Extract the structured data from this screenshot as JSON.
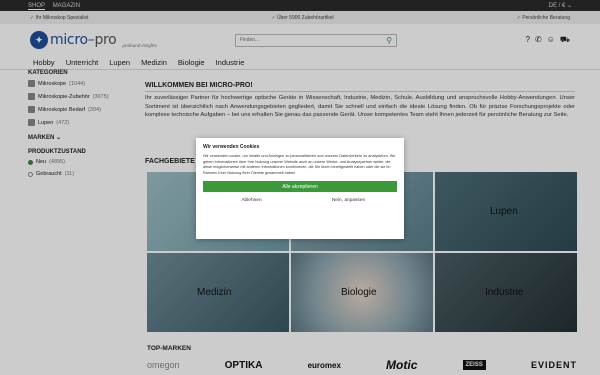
{
  "topbar": {
    "nav": [
      "SHOP",
      "MAGAZIN"
    ],
    "lang": "DE / € ⌄"
  },
  "usp": [
    "Ihr Mikroskop Spezialist",
    "Über 5900 Zubehörartikel",
    "Persönliche Beratung"
  ],
  "header": {
    "logo_name_a": "micro",
    "logo_name_b": "–pro",
    "logo_tag": "profound insights",
    "search_placeholder": "Finden..."
  },
  "icons": [
    "help-icon",
    "phone-icon",
    "user-icon",
    "cart-icon"
  ],
  "mainnav": [
    "Hobby",
    "Unterricht",
    "Lupen",
    "Medizin",
    "Biologie",
    "Industrie"
  ],
  "sidebar": {
    "kategorien_title": "KATEGORIEN",
    "kategorien": [
      {
        "label": "Mikroskope",
        "count": "(1044)"
      },
      {
        "label": "Mikroskopie-Zubehör",
        "count": "(3075)"
      },
      {
        "label": "Mikroskopie Bedarf",
        "count": "(304)"
      },
      {
        "label": "Lupen",
        "count": "(472)"
      }
    ],
    "marken_title": "MARKEN",
    "zustand_title": "PRODUKTZUSTAND",
    "zustand": [
      {
        "label": "Neu",
        "count": "(4895)"
      },
      {
        "label": "Gebraucht",
        "count": "(11)"
      }
    ]
  },
  "content": {
    "title": "WILLKOMMEN BEI MICRO-PRO!",
    "text": "Ihr zuverlässiger Partner für hochwertige optische Geräte in Wissenschaft, Industrie, Medizin, Schule, Ausbildung und anspruchsvolle Hobby-Anwendungen. Unser Sortiment ist übersichtlich nach Anwendungsgebieten gegliedert, damit Sie schnell und einfach die ideale Lösung finden. Ob für präzise Forschungsprojekte oder komplexe technische Aufgaben – bei uns erhalten Sie genau das passende Gerät. Unser kompetentes Team steht Ihnen jederzeit für persönliche Beratung zur Seite."
  },
  "fachgebiete": {
    "title": "FACHGEBIETE",
    "tiles": [
      "",
      "",
      "Lupen",
      "Medizin",
      "Biologie",
      "Industrie"
    ]
  },
  "brands": {
    "title": "TOP-MARKEN",
    "items": [
      "omegon",
      "OPTIKA",
      "euromex",
      "Motic",
      "ZEISS",
      "EVIDENT"
    ]
  },
  "cookie": {
    "title": "Wir verwenden Cookies",
    "text": "Wir verwenden cookie, um Inhalte und Anzeigen zu personalisieren und unseren Datenverkehr zu analysieren. Wir geben Informationen über Ihre Nutzung unserer Website auch an unsere Werbe- und Analysepartner weiter, die diese möglicherweise mit anderen Informationen kombinieren, die Sie ihnen bereitgestellt haben oder die sie im Rahmen Ihrer Nutzung ihrer Dienste gesammelt haben",
    "accept": "Alle akzeptieren",
    "reject": "Ablehnen",
    "customize": "Nein, anpassen"
  }
}
